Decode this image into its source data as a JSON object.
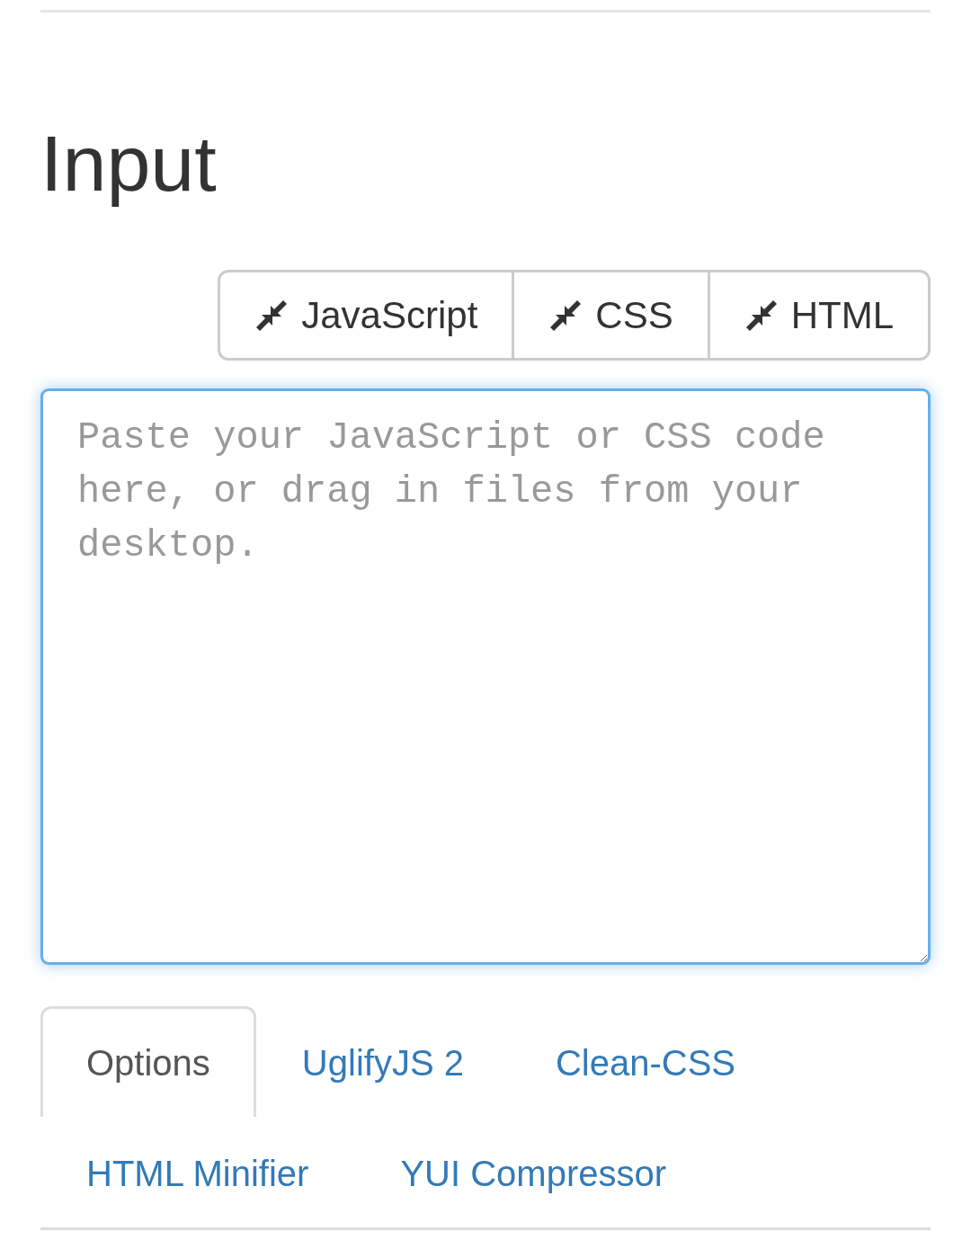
{
  "heading": "Input",
  "toolbar": [
    {
      "label": "JavaScript"
    },
    {
      "label": "CSS"
    },
    {
      "label": "HTML"
    }
  ],
  "editor": {
    "placeholder": "Paste your JavaScript or CSS code here, or drag in files from your desktop.",
    "focused": true
  },
  "tabs": [
    {
      "label": "Options",
      "selected": true
    },
    {
      "label": "UglifyJS 2",
      "selected": false
    },
    {
      "label": "Clean-CSS",
      "selected": false
    },
    {
      "label": "HTML Minifier",
      "selected": false
    },
    {
      "label": "YUI Compressor",
      "selected": false
    }
  ]
}
